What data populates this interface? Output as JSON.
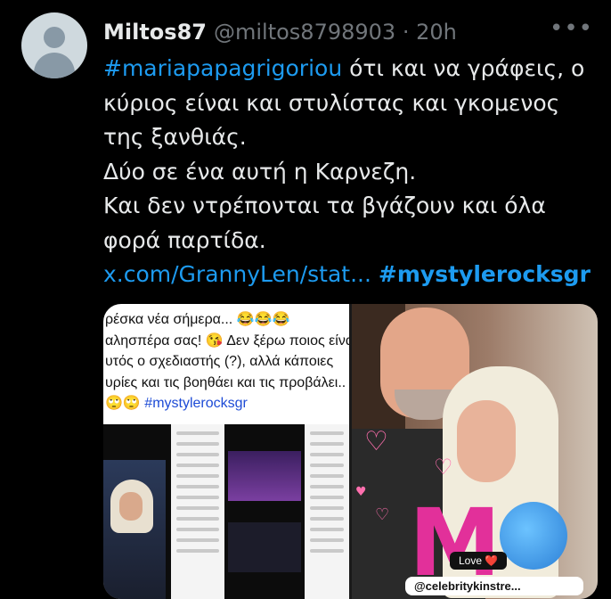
{
  "author": {
    "display_name": "Miltos87",
    "handle_time": "@miltos8798903 · 20h",
    "more_icon": "ellipsis-icon"
  },
  "tweet": {
    "hashtag": "#mariapapagrigoriou",
    "line1_rest": " ότι και να γράφεις, ο",
    "line2": "κύριος είναι και στυλίστας και γκομενος",
    "line3": "της ξανθιάς.",
    "line4": "Δύο σε ένα αυτή η Καρνεζη.",
    "line5": "Και δεν ντρέπονται τα βγάζουν και όλα",
    "line6": "φορά παρτίδα.",
    "link": "x.com/GrannyLen/stat...",
    "hashtag2": "#mystylerocksgr"
  },
  "media": {
    "caption_lines": [
      "ρέσκα νέα σήμερα... 😂😂😂",
      "αλησπέρα σας! 😘 Δεν ξέρω ποιος είνα",
      "υτός ο σχεδιαστής (?), αλλά κάποιες",
      "υρίες και τις βοηθάει και τις προβάλει..",
      "🙄🙄 #mystylerocksgr"
    ],
    "love_label": "Love ❤️",
    "username_sticker": "@celebritykinstre..."
  },
  "colors": {
    "link": "#1d9bf0",
    "text": "#e7e9ea",
    "muted": "#71767b",
    "background": "#000000"
  }
}
